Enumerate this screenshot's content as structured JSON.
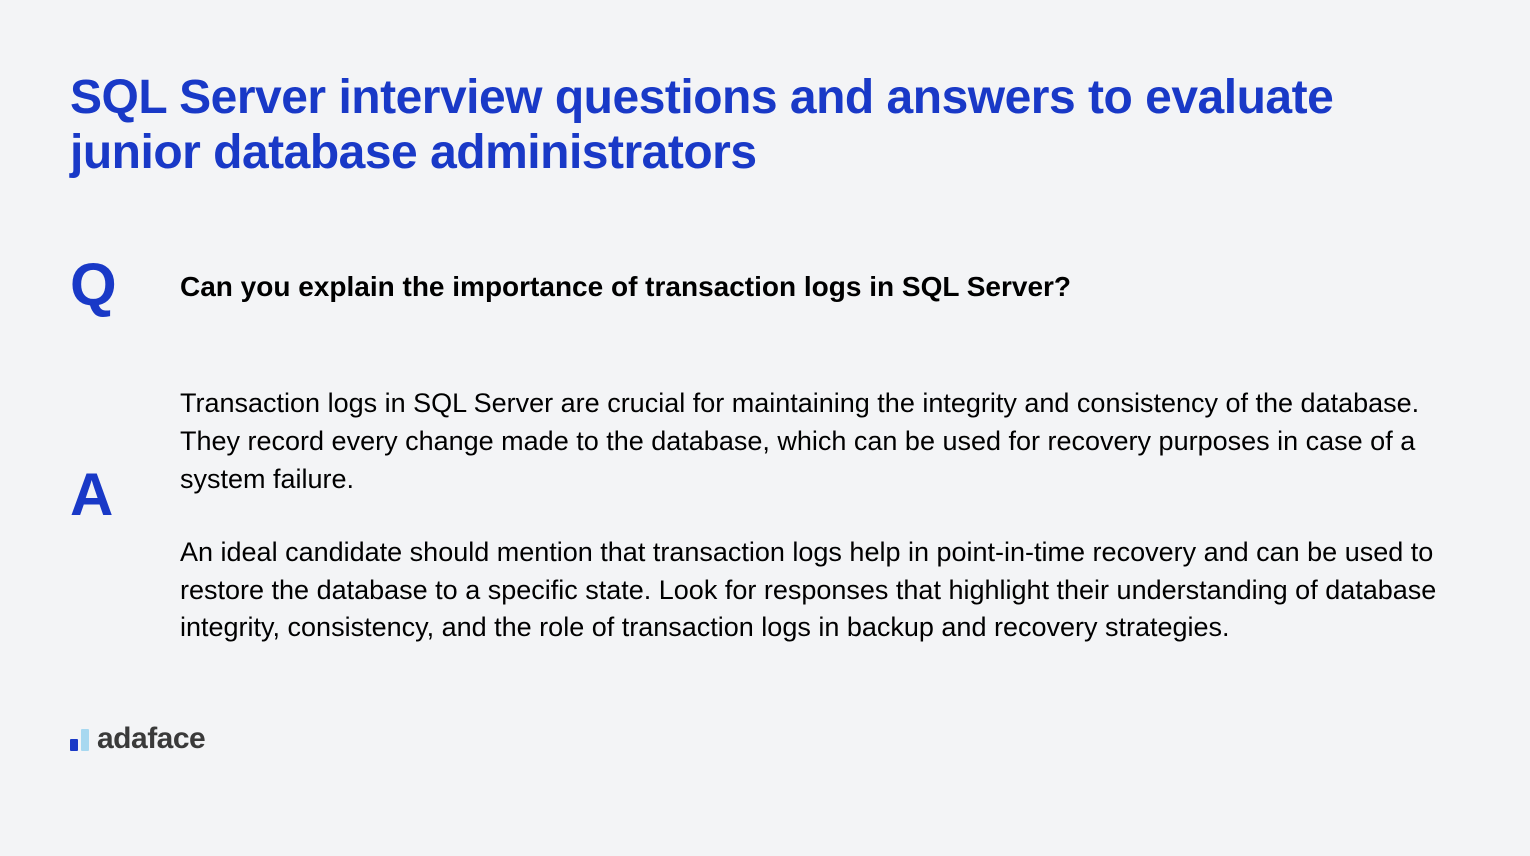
{
  "title": "SQL Server interview questions and answers to evaluate junior database administrators",
  "question_marker": "Q",
  "answer_marker": "A",
  "question_text": "Can you explain the importance of transaction logs in SQL Server?",
  "answer_para1": "Transaction logs in SQL Server are crucial for maintaining the integrity and consistency of the database. They record every change made to the database, which can be used for recovery purposes in case of a system failure.",
  "answer_para2": "An ideal candidate should mention that transaction logs help in point-in-time recovery and can be used to restore the database to a specific state. Look for responses that highlight their understanding of database integrity, consistency, and the role of transaction logs in backup and recovery strategies.",
  "logo_text": "adaface"
}
